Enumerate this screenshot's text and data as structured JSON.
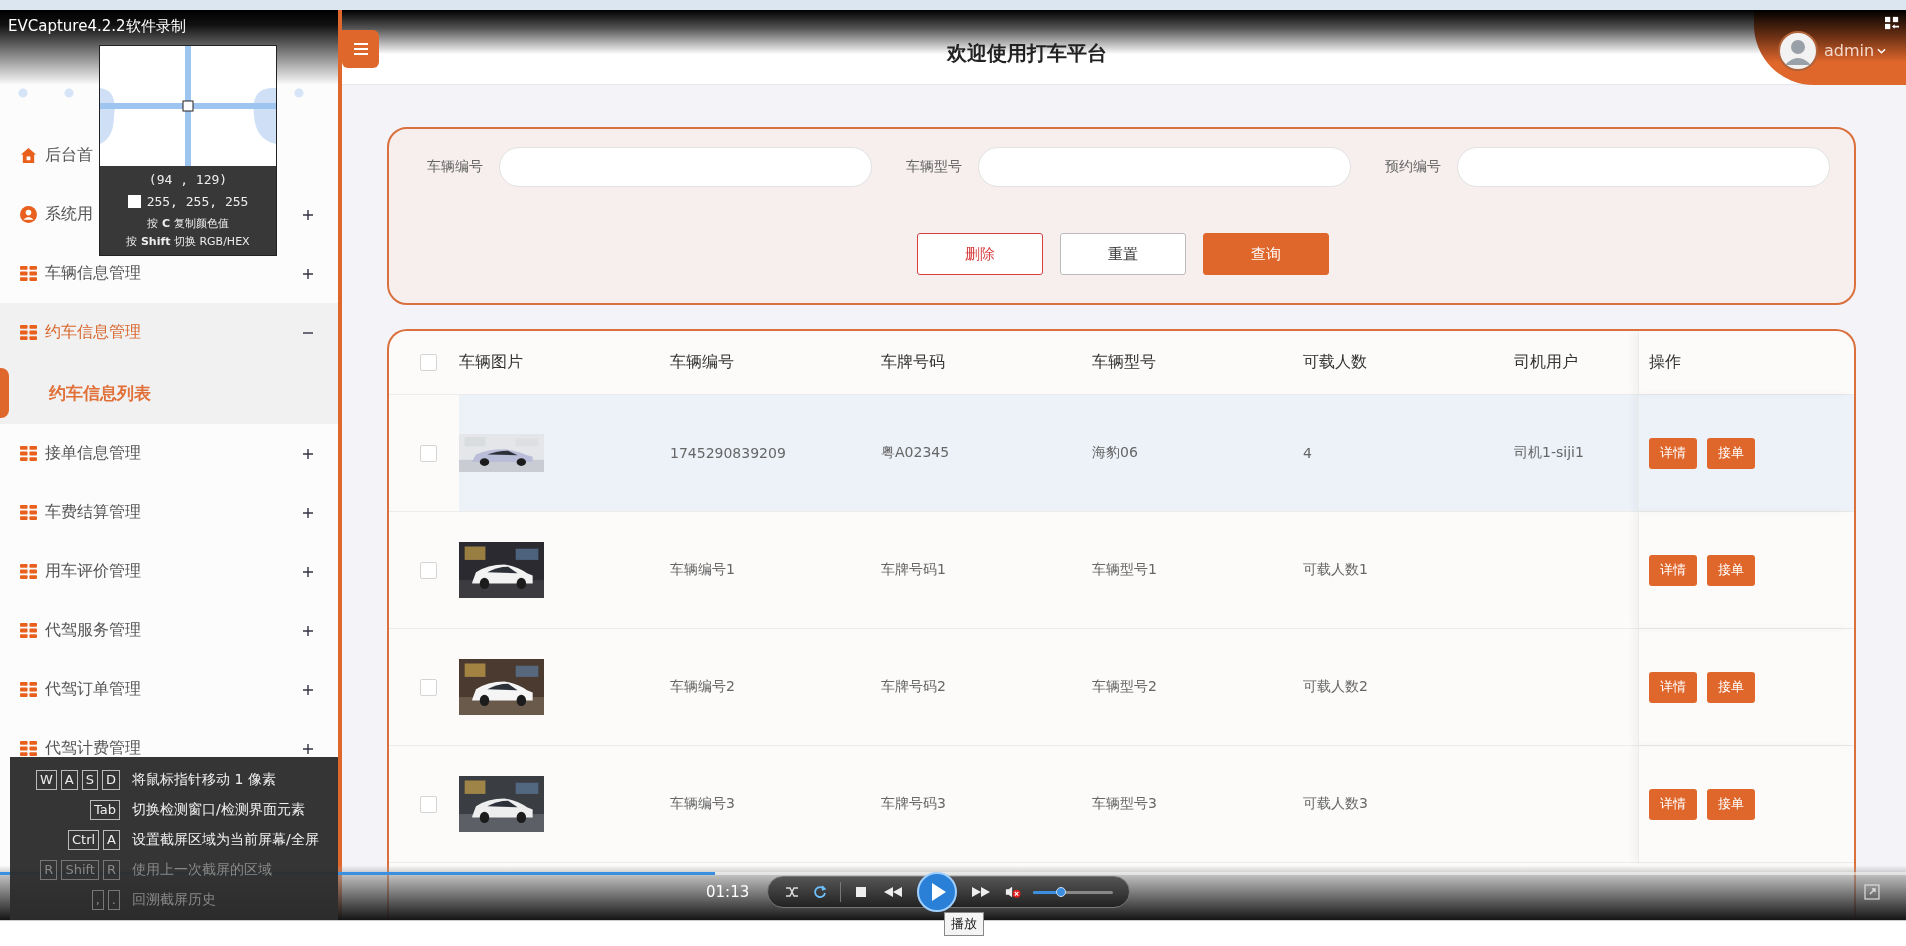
{
  "recorder": {
    "title": "EVCapture4.2.2软件录制"
  },
  "sidebar": {
    "items": [
      {
        "label": "后台首",
        "kind": "home"
      },
      {
        "label": "系统用",
        "kind": "user",
        "expanded": false
      },
      {
        "label": "车辆信息管理",
        "kind": "module",
        "expanded": false
      },
      {
        "label": "约车信息管理",
        "kind": "module",
        "expanded": true,
        "children": [
          {
            "label": "约车信息列表",
            "selected": true
          }
        ]
      },
      {
        "label": "接单信息管理",
        "kind": "module",
        "expanded": false
      },
      {
        "label": "车费结算管理",
        "kind": "module",
        "expanded": false
      },
      {
        "label": "用车评价管理",
        "kind": "module",
        "expanded": false
      },
      {
        "label": "代驾服务管理",
        "kind": "module",
        "expanded": false
      },
      {
        "label": "代驾订单管理",
        "kind": "module",
        "expanded": false
      },
      {
        "label": "代驾计费管理",
        "kind": "module",
        "expanded": false
      }
    ]
  },
  "header": {
    "title": "欢迎使用打车平台",
    "user": "admin"
  },
  "search": {
    "fields": [
      {
        "label": "车辆编号"
      },
      {
        "label": "车辆型号"
      },
      {
        "label": "预约编号"
      }
    ],
    "buttons": [
      {
        "label": "删除",
        "kind": "danger"
      },
      {
        "label": "重置",
        "kind": "plain"
      },
      {
        "label": "查询",
        "kind": "primary"
      }
    ]
  },
  "table": {
    "all_checked": false,
    "picture_column": "车辆图片",
    "columns": [
      "车辆编号",
      "车牌号码",
      "车辆型号",
      "可载人数",
      "司机用户"
    ],
    "actions_column": "操作",
    "rows": [
      {
        "selected": true,
        "checked": false,
        "cells": [
          "1745290839209",
          "粤A02345",
          "海豹06",
          "4",
          "司机1-siji1"
        ],
        "actions": [
          "详情",
          "接单"
        ]
      },
      {
        "selected": false,
        "checked": false,
        "cells": [
          "车辆编号1",
          "车牌号码1",
          "车辆型号1",
          "可载人数1"
        ],
        "actions": [
          "详情",
          "接单"
        ]
      },
      {
        "selected": false,
        "checked": false,
        "cells": [
          "车辆编号2",
          "车牌号码2",
          "车辆型号2",
          "可载人数2"
        ],
        "actions": [
          "详情",
          "接单"
        ]
      },
      {
        "selected": false,
        "checked": false,
        "cells": [
          "车辆编号3",
          "车牌号码3",
          "车辆型号3",
          "可载人数3"
        ],
        "actions": [
          "详情",
          "接单"
        ]
      }
    ]
  },
  "picker": {
    "coords": "(94 , 129)",
    "rgb_text": "255, 255, 255",
    "hints": [
      "按 **C** 复制颜色值",
      "按 **Shift** 切换 RGB/HEX"
    ]
  },
  "shortcuts": [
    {
      "keys": [
        "W",
        "A",
        "S",
        "D"
      ],
      "text": "将鼠标指针移动 1 像素",
      "dimmed": false
    },
    {
      "keys": [
        "Tab"
      ],
      "text": "切换检测窗口/检测界面元素",
      "dimmed": false
    },
    {
      "keys": [
        "Ctrl",
        "A"
      ],
      "text": "设置截屏区域为当前屏幕/全屏",
      "dimmed": false
    },
    {
      "keys": [
        "R",
        "Shift",
        "R"
      ],
      "text": "使用上一次截屏的区域",
      "dimmed": true
    },
    {
      "keys": [
        ",",
        "."
      ],
      "text": "回溯截屏历史",
      "dimmed": true
    }
  ],
  "player": {
    "time": "01:13",
    "progress": {
      "level": 0.375
    },
    "volume": {
      "level": 0.35
    },
    "muted": true,
    "tooltip": "播放"
  }
}
